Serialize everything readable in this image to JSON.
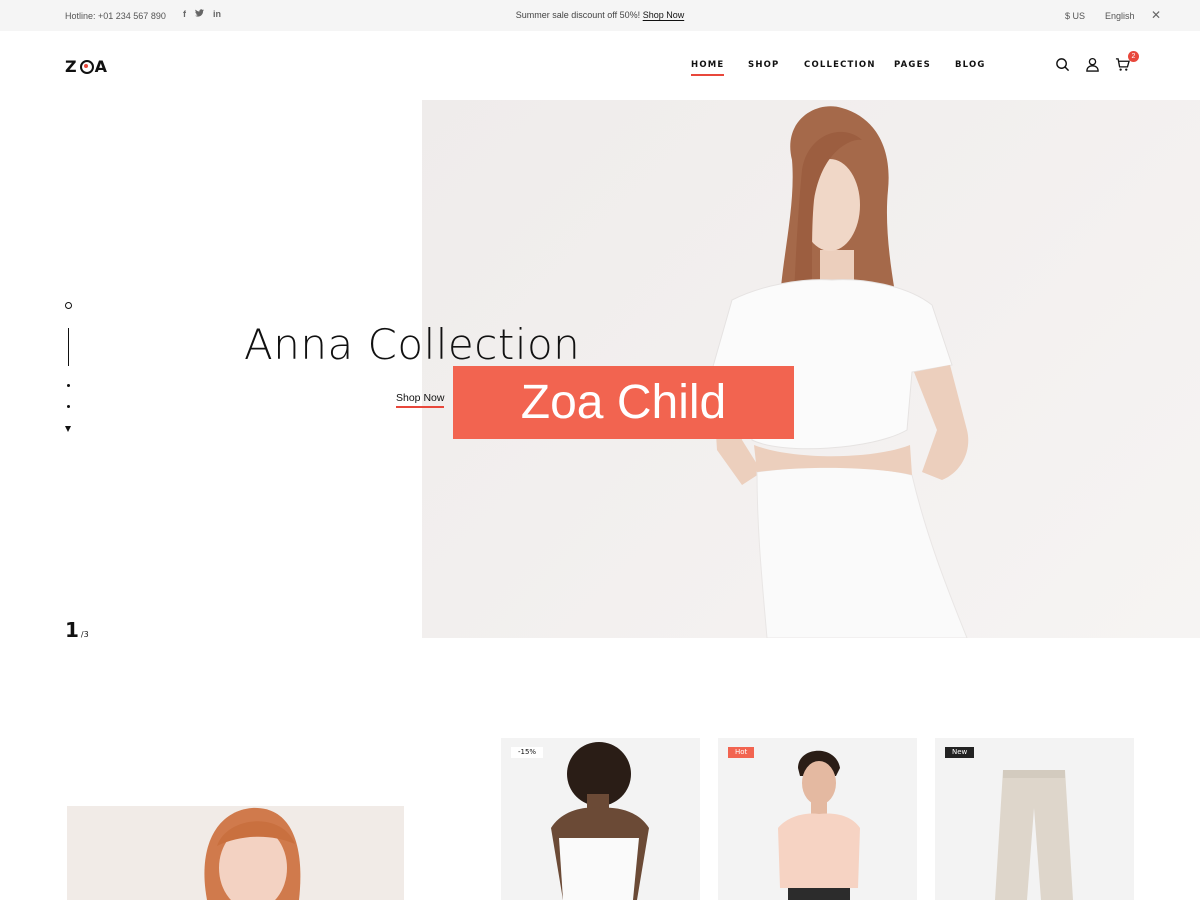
{
  "topbar": {
    "hotline": "Hotline: +01 234 567 890",
    "social_icons": [
      "facebook-icon",
      "twitter-icon",
      "linkedin-icon"
    ],
    "social_glyphs": {
      "facebook": "f",
      "twitter": "t",
      "linkedin": "in"
    },
    "promo_text": "Summer sale discount off 50%!",
    "promo_link": "Shop Now",
    "currency": "$ US",
    "language": "English",
    "close_glyph": "✕"
  },
  "header": {
    "logo": "ZOA",
    "nav": [
      {
        "label": "HOME",
        "active": true
      },
      {
        "label": "SHOP",
        "active": false
      },
      {
        "label": "COLLECTION",
        "active": false
      },
      {
        "label": "PAGES",
        "active": false
      },
      {
        "label": "BLOG",
        "active": false
      }
    ],
    "icons": [
      "search-icon",
      "user-icon",
      "cart-icon"
    ],
    "cart_count": "2"
  },
  "hero": {
    "title": "Anna Collection",
    "button": "Shop Now",
    "overlay_badge": "Zoa Child",
    "slide_current": "1",
    "slide_total": "/3"
  },
  "products": [
    {
      "tag": "-15%",
      "tag_type": "sale"
    },
    {
      "tag": "Hot",
      "tag_type": "hot"
    },
    {
      "tag": "New",
      "tag_type": "new"
    }
  ],
  "colors": {
    "accent": "#e8473b",
    "badge_bg": "#f26450",
    "topbar_bg": "#f5f5f5",
    "hero_bg": "#efeceb"
  }
}
